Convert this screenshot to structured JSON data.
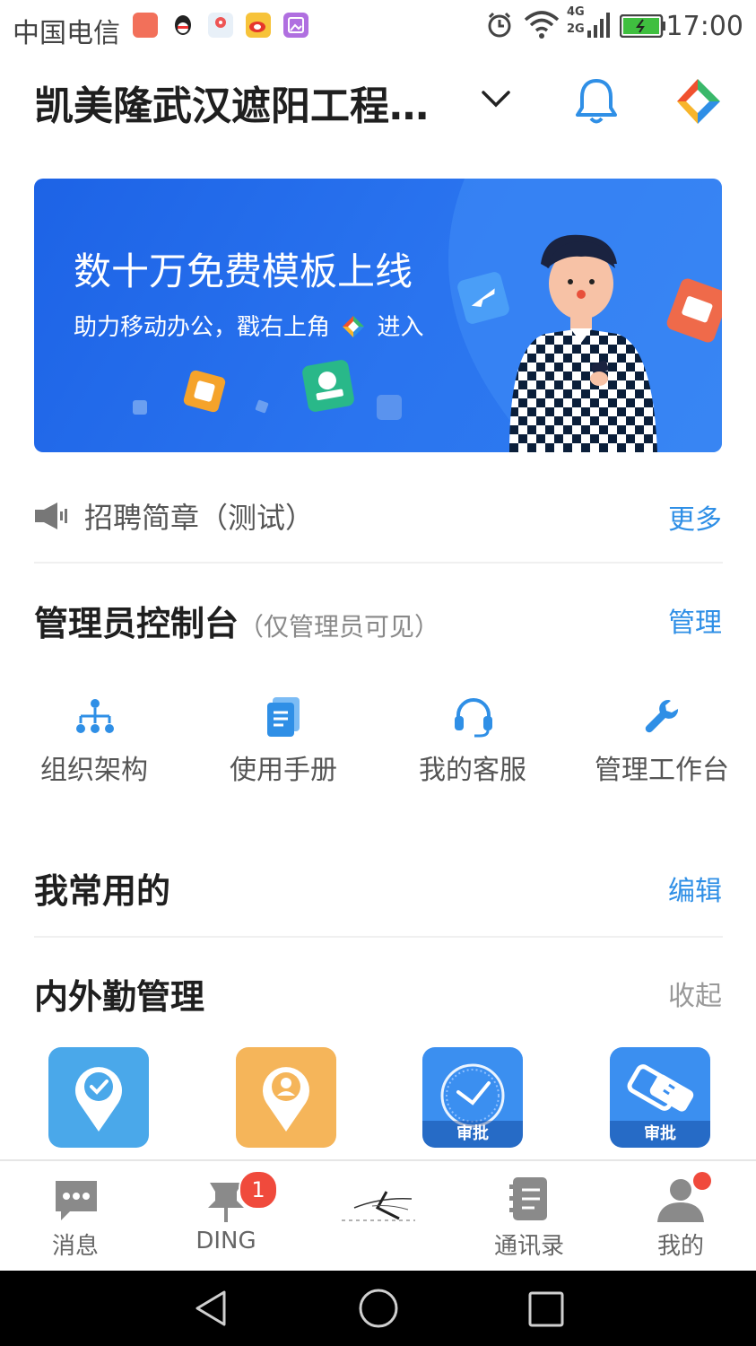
{
  "status_bar": {
    "carrier": "中国电信",
    "network_label_top": "4G",
    "network_label_bottom": "2G",
    "time": "17:00"
  },
  "header": {
    "org_name": "凯美隆武汉遮阳工程有限公司",
    "dropdown_icon": "chevron-down-icon",
    "bell_icon": "bell-icon",
    "apps_icon": "colorful-star-icon"
  },
  "banner": {
    "title": "数十万免费模板上线",
    "subtitle_pre": "助力移动办公，戳右上角",
    "subtitle_post": "进入"
  },
  "notice": {
    "text": "招聘简章（测试）",
    "more_label": "更多"
  },
  "admin_console": {
    "title": "管理员控制台",
    "note": "（仅管理员可见）",
    "manage_label": "管理",
    "tools": [
      {
        "label": "组织架构",
        "icon": "org-chart-icon"
      },
      {
        "label": "使用手册",
        "icon": "manual-icon"
      },
      {
        "label": "我的客服",
        "icon": "headset-icon"
      },
      {
        "label": "管理工作台",
        "icon": "wrench-icon"
      }
    ]
  },
  "favorites": {
    "title": "我常用的",
    "edit_label": "编辑"
  },
  "attendance": {
    "title": "内外勤管理",
    "collapse_label": "收起",
    "apps": [
      {
        "icon": "location-check-icon",
        "color": "#4aa8ea",
        "badge": ""
      },
      {
        "icon": "location-person-icon",
        "color": "#f5b55a",
        "badge": ""
      },
      {
        "icon": "clock-icon",
        "color": "#3b8ff0",
        "badge": "审批"
      },
      {
        "icon": "handshake-icon",
        "color": "#3b8ff0",
        "badge": "审批"
      }
    ]
  },
  "tabbar": {
    "tabs": [
      {
        "label": "消息",
        "icon": "message-icon"
      },
      {
        "label": "DING",
        "icon": "pin-icon",
        "badge": "1"
      },
      {
        "label": "",
        "icon": "company-logo-icon"
      },
      {
        "label": "通讯录",
        "icon": "contacts-icon"
      },
      {
        "label": "我的",
        "icon": "person-icon",
        "dot": true
      }
    ]
  },
  "colors": {
    "accent": "#2f8fe6",
    "banner": "#2a74ef",
    "badge": "#f04a3c"
  }
}
